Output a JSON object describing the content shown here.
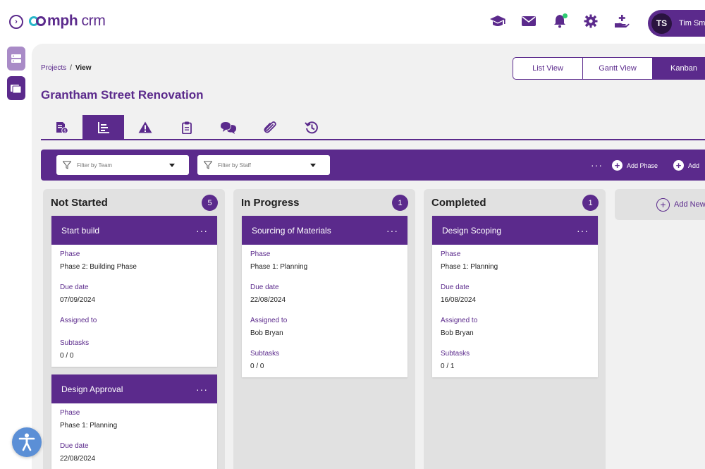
{
  "app": {
    "logo_bold": "mph",
    "logo_light": "crm",
    "accent_color": "#5b2a8c",
    "logo_ring_color": "#29b6c8"
  },
  "header": {
    "icons": [
      "graduation-cap-icon",
      "mail-icon",
      "bell-icon",
      "gear-icon",
      "hand-plus-icon"
    ],
    "user": {
      "initials": "TS",
      "name": "Tim Smi"
    }
  },
  "breadcrumb": {
    "parent": "Projects",
    "separator": "/",
    "current": "View"
  },
  "page": {
    "title": "Grantham Street Renovation"
  },
  "views": [
    {
      "label": "List View",
      "active": false
    },
    {
      "label": "Gantt View",
      "active": false
    },
    {
      "label": "Kanban",
      "active": true
    }
  ],
  "tabs": [
    {
      "icon": "document-money-icon",
      "active": false
    },
    {
      "icon": "bar-chart-icon",
      "active": true
    },
    {
      "icon": "warning-icon",
      "active": false
    },
    {
      "icon": "clipboard-icon",
      "active": false
    },
    {
      "icon": "chat-bubbles-icon",
      "active": false
    },
    {
      "icon": "paperclip-icon",
      "active": false
    },
    {
      "icon": "history-icon",
      "active": false
    }
  ],
  "filters": {
    "team_placeholder": "Filter by Team",
    "staff_placeholder": "Filter by Staff",
    "more": "···",
    "add_phase": "Add Phase",
    "add_second": "Add"
  },
  "columns": [
    {
      "title": "Not Started",
      "count": "5",
      "cards": [
        {
          "title": "Start build",
          "phase_label": "Phase",
          "phase": "Phase 2: Building Phase",
          "due_label": "Due date",
          "due": "07/09/2024",
          "assigned_label": "Assigned to",
          "assigned": "",
          "subtasks_label": "Subtasks",
          "subtasks": "0 / 0"
        },
        {
          "title": "Design Approval",
          "phase_label": "Phase",
          "phase": "Phase 1: Planning",
          "due_label": "Due date",
          "due": "22/08/2024"
        }
      ]
    },
    {
      "title": "In Progress",
      "count": "1",
      "cards": [
        {
          "title": "Sourcing of Materials",
          "phase_label": "Phase",
          "phase": "Phase 1: Planning",
          "due_label": "Due date",
          "due": "22/08/2024",
          "assigned_label": "Assigned to",
          "assigned": "Bob Bryan",
          "subtasks_label": "Subtasks",
          "subtasks": "0 / 0"
        }
      ]
    },
    {
      "title": "Completed",
      "count": "1",
      "cards": [
        {
          "title": "Design Scoping",
          "phase_label": "Phase",
          "phase": "Phase 1: Planning",
          "due_label": "Due date",
          "due": "16/08/2024",
          "assigned_label": "Assigned to",
          "assigned": "Bob Bryan",
          "subtasks_label": "Subtasks",
          "subtasks": "0 / 1"
        }
      ]
    }
  ],
  "add_new_column": "Add New"
}
